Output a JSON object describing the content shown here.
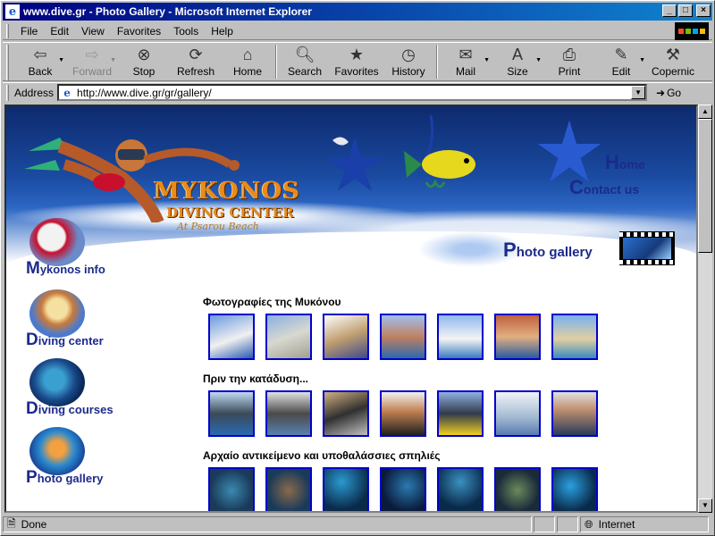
{
  "window": {
    "title": "www.dive.gr - Photo Gallery - Microsoft Internet Explorer",
    "min": "_",
    "max": "□",
    "close": "×"
  },
  "menu": [
    "File",
    "Edit",
    "View",
    "Favorites",
    "Tools",
    "Help"
  ],
  "toolbar": {
    "back": "Back",
    "forward": "Forward",
    "stop": "Stop",
    "refresh": "Refresh",
    "home": "Home",
    "search": "Search",
    "favorites": "Favorites",
    "history": "History",
    "mail": "Mail",
    "size": "Size",
    "print": "Print",
    "edit": "Edit",
    "copernic": "Copernic"
  },
  "address": {
    "label": "Address",
    "url": "http://www.dive.gr/gr/gallery/",
    "go": "Go"
  },
  "status": {
    "text": "Done",
    "zone": "Internet"
  },
  "page": {
    "brand": {
      "line1": "MYKONOS",
      "line2": "DIVING CENTER",
      "line3": "At Psarou Beach"
    },
    "nav": {
      "home_cap": "H",
      "home_rest": "ome",
      "contact_cap": "C",
      "contact_rest": "ontact us"
    },
    "gallery_title_cap": "P",
    "gallery_title_rest": "hoto gallery",
    "left": [
      {
        "cap": "M",
        "rest": "ykonos info"
      },
      {
        "cap": "D",
        "rest": "iving center"
      },
      {
        "cap": "D",
        "rest": "iving courses"
      },
      {
        "cap": "P",
        "rest": "hoto gallery"
      }
    ],
    "sections": [
      {
        "title": "Φωτογραφίες της Μυκόνου"
      },
      {
        "title": "Πριν την κατάδυση..."
      },
      {
        "title": "Αρχαίο αντικείμενο και υποθαλάσσιες σπηλιές"
      }
    ]
  }
}
